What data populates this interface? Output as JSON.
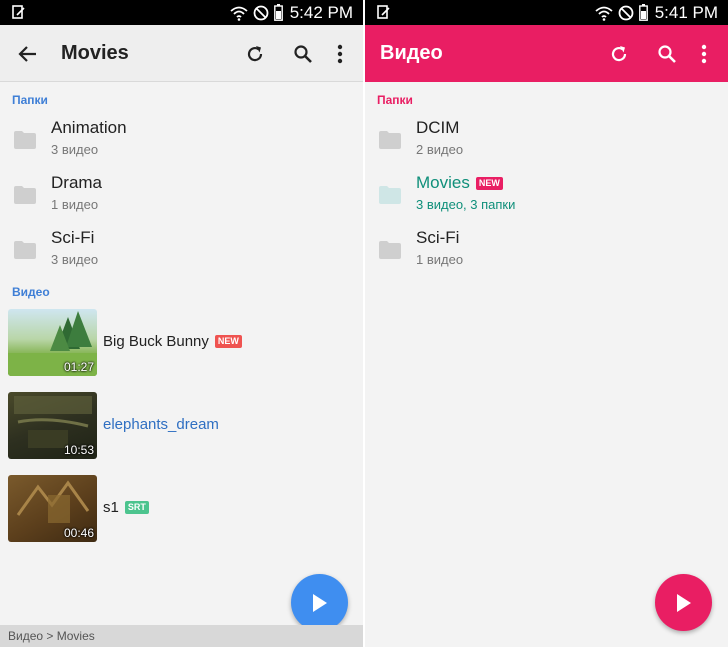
{
  "colors": {
    "left_accent": "#3f7fd6",
    "right_toolbar": "#e91e63",
    "active_folder": "#0f8f7a",
    "fab_left": "#3f8ef0",
    "fab_right": "#e91e63"
  },
  "left": {
    "status": {
      "time": "5:42 PM"
    },
    "toolbar": {
      "title": "Movies",
      "icons": [
        "back-arrow-icon",
        "refresh-icon",
        "search-icon",
        "more-vert-icon"
      ]
    },
    "folders_header": "Папки",
    "folders": [
      {
        "name": "Animation",
        "meta": "3 видео"
      },
      {
        "name": "Drama",
        "meta": "1 видео"
      },
      {
        "name": "Sci-Fi",
        "meta": "3 видео"
      }
    ],
    "videos_header": "Видео",
    "videos": [
      {
        "title": "Big Buck Bunny",
        "duration": "01:27",
        "badge": "NEW"
      },
      {
        "title": "elephants_dream",
        "duration": "10:53"
      },
      {
        "title": "s1",
        "duration": "00:46",
        "badge": "SRT"
      }
    ],
    "breadcrumb": "Видео > Movies"
  },
  "right": {
    "status": {
      "time": "5:41 PM"
    },
    "toolbar": {
      "title": "Видео",
      "icons": [
        "refresh-icon",
        "search-icon",
        "more-vert-icon"
      ]
    },
    "folders_header": "Папки",
    "folders": [
      {
        "name": "DCIM",
        "meta": "2 видео"
      },
      {
        "name": "Movies",
        "meta": "3 видео, 3 папки",
        "badge": "NEW"
      },
      {
        "name": "Sci-Fi",
        "meta": "1 видео"
      }
    ]
  }
}
